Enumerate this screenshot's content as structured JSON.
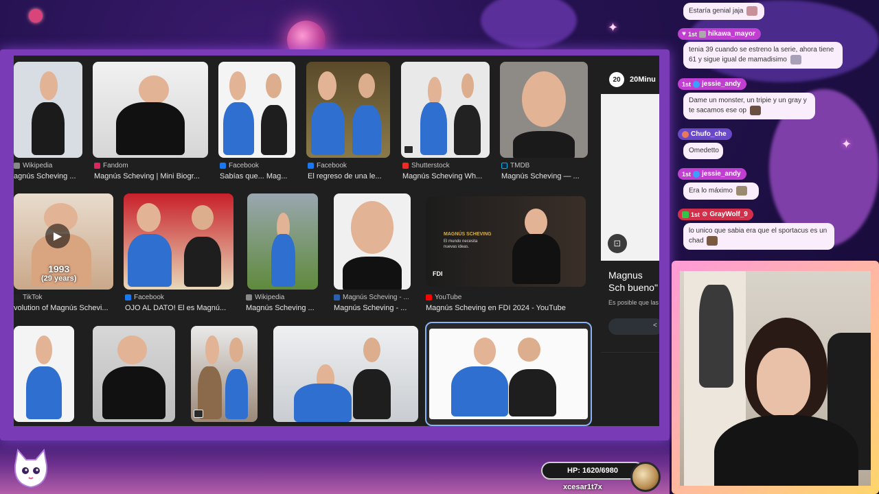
{
  "colors": {
    "frame": "#7a3bb7",
    "browser_bg": "#1f1f1f",
    "chat_bubble": "#fbeefc",
    "selected_border": "#8ab4f8"
  },
  "image_results": [
    {
      "source": "Wikipedia",
      "caption": "agnús Scheving ...",
      "fav": "#888888"
    },
    {
      "source": "Fandom",
      "caption": "Magnús Scheving | Mini Biogr...",
      "fav": "#e0245e"
    },
    {
      "source": "Facebook",
      "caption": "Sabías que... Mag...",
      "fav": "#1877f2"
    },
    {
      "source": "Facebook",
      "caption": "El regreso de una le...",
      "fav": "#1877f2"
    },
    {
      "source": "Shutterstock",
      "caption": "Magnús Scheving Wh...",
      "fav": "#ee2b24"
    },
    {
      "source": "TMDB",
      "caption": "Magnús Scheving — ...",
      "fav": "#0d253f"
    },
    {
      "source": "TikTok",
      "caption": "volution of Magnús Schevi...",
      "fav": "#222222"
    },
    {
      "source": "Facebook",
      "caption": "OJO AL DATO! El es Magnú...",
      "fav": "#1877f2"
    },
    {
      "source": "Wikipedia",
      "caption": "Magnús Scheving ...",
      "fav": "#888888"
    },
    {
      "source": "Magnús Scheving - ...",
      "caption": "Magnús Scheving - ...",
      "fav": "#2b5fb0"
    },
    {
      "source": "YouTube",
      "caption": "Magnús Scheving en FDI 2024 - YouTube",
      "fav": "#ff0000"
    }
  ],
  "video_overlay": {
    "year": "1993",
    "age": "(29 years)"
  },
  "fdi_slide": {
    "line1": "MAGNÚS SCHEVING",
    "line2": "El mundo necesita",
    "line3": "nuevas ideas.",
    "logo": "FDI"
  },
  "side_panel": {
    "logo": "20",
    "site": "20Minu",
    "title": "Magnus Sch bueno\"",
    "desc": "Es posible que las",
    "arrow": "<"
  },
  "chat": [
    {
      "user": "",
      "text": "Estaría genial jaja"
    },
    {
      "user": "hikawa_mayor",
      "text": "tenia 39 cuando se estreno la serie, ahora tiene 61 y sigue igual de mamadisimo"
    },
    {
      "user": "jessie_andy",
      "text": "Dame un monster, un tripie y un gray y te sacamos ese op"
    },
    {
      "user": "Chufo_che",
      "text": "Omedetto"
    },
    {
      "user": "jessie_andy",
      "text": "Era lo máximo"
    },
    {
      "user": "GrayWolf_9",
      "text": "lo unico que sabia era que el sportacus es un chad"
    }
  ],
  "badge_text": "1st",
  "hp": {
    "label": "HP: 1620/6980",
    "username": "xcesar1t7x"
  }
}
